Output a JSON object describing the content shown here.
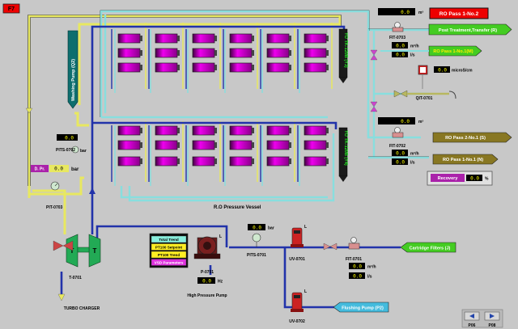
{
  "page_id": "F7",
  "title_banner": "RO Pass 1-No.2",
  "labels": {
    "washing_pump": "Washing Pump (Q2)",
    "tank_top": "YO TK-120B (Y3)",
    "tank_bottom": "YO TK-120B (Y4)",
    "ro_pressure_vessel": "R.O Pressure Vessel",
    "turbo_charger": "TURBO CHARGER",
    "high_pressure_pump": "High Pressure Pump",
    "t_left": "T",
    "t_right": "T",
    "pit_0703_left": "PIT-0703",
    "pits_0702": "PITS-0702",
    "pits_0701": "PITS-0701",
    "fit_0703": "FIT-0703",
    "fit_0702": "FIT-0702",
    "fit_0701": "FIT-0701",
    "qit_0701": "QIT-0701",
    "uv_0701": "UV-0701",
    "uv_0702": "UV-0702",
    "t_0701": "T-0701",
    "p_0701": "P-0701",
    "l_motor": "L",
    "l_uv1": "L",
    "l_uv2": "L",
    "d_pr": "D. Pr."
  },
  "flows": {
    "post_treatment": "Post Treatment,Transfer (R)",
    "ro_pass_1_m": "RO Pass 1-No.1(M)",
    "ro_pass_2_s": "RO Pass 2-No.1 (S)",
    "ro_pass_1_n": "RO Pass 1-No.1 (N)",
    "cartridge_filters": "Cartridge Filters (J)",
    "flushing_pump": "Flushing Pump (P2)"
  },
  "readings": {
    "fit_0703_total": {
      "value": "0.0",
      "unit": "m³"
    },
    "fit_0703_flow": {
      "value": "0.0",
      "unit": "m³/h"
    },
    "fit_0703_lps": {
      "value": "0.0",
      "unit": "l/s"
    },
    "fit_0702_total": {
      "value": "0.0",
      "unit": "m³"
    },
    "fit_0702_flow": {
      "value": "0.0",
      "unit": "m³/h"
    },
    "fit_0702_lps": {
      "value": "0.0",
      "unit": "l/s"
    },
    "fit_0701_flow": {
      "value": "0.0",
      "unit": "m³/h"
    },
    "fit_0701_lps": {
      "value": "0.0",
      "unit": "l/s"
    },
    "qit_0701": {
      "value": "0.0",
      "unit": "microS/cm"
    },
    "pits_0702": {
      "value": "0.0",
      "unit": "bar"
    },
    "pits_0701": {
      "value": "0.0",
      "unit": "bar"
    },
    "d_pr": {
      "value": "0.0",
      "unit": "bar"
    },
    "motor_hz": {
      "value": "0.0",
      "unit": "Hz"
    },
    "recovery": {
      "label": "Recovery",
      "value": "0.0",
      "unit": "%"
    }
  },
  "trend_buttons": [
    "Total Trend",
    "PT100 Setpoint",
    "PT100 Trend",
    "VSD Parameters"
  ],
  "nav": {
    "prev": "P06",
    "next": "P08"
  },
  "colors": {
    "membrane": "#cc00cc",
    "pipe_blue": "#2233aa",
    "pipe_cyan": "#88dddd",
    "pipe_yellow": "#f0f070",
    "flow_arrow": "#33cc33",
    "banner": "#ee0000"
  }
}
